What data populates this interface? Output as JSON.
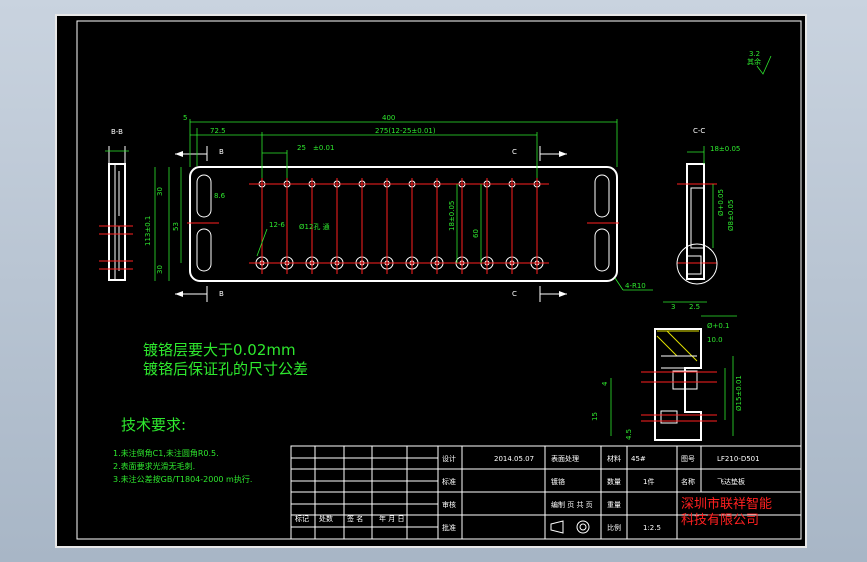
{
  "section_labels": {
    "bb": "B-B",
    "cc": "C-C",
    "b": "B",
    "c": "C"
  },
  "roughness": {
    "value": "3.2",
    "label": "其余"
  },
  "dimensions": {
    "d400": "400",
    "d5": "5",
    "d72_5": "72.5",
    "d275": "275(12-25±0.01)",
    "d25": "25",
    "d25tol": "±0.01",
    "d86": "8.6",
    "d30a": "30",
    "d53": "53",
    "d113": "113±0.1",
    "d30b": "30",
    "d12_6": "12-6",
    "d12_hole": "Ø12孔 通",
    "d18": "18±0.05",
    "d60": "60",
    "d4_r10": "4-R10",
    "c_top": "18±0.05",
    "c_v1": "Ø+0.05",
    "c_v2": "Ø8±0.05",
    "c_bottom_a": "3",
    "c_bottom_b": "2.5",
    "det_d1": "Ø+0.1",
    "det_d2": "10.0",
    "det_v1": "4",
    "det_v2": "15",
    "det_v3": "4.5",
    "det_v4": "Ø15±0.01"
  },
  "notes": {
    "plating_1": "镀铬层要大于0.02mm",
    "plating_2": "镀铬后保证孔的尺寸公差",
    "tech_title": "技术要求:",
    "tech_1": "1.未注倒角C1,未注圆角R0.5.",
    "tech_2": "2.表面要求光滑无毛刺.",
    "tech_3": "3.未注公差按GB/T1804-2000 m执行."
  },
  "title_block": {
    "design": "设计",
    "date": "2014.05.07",
    "surface_label": "表面处理",
    "material_label": "材料",
    "material_value": "45#",
    "drawing_no_label": "图号",
    "drawing_no_value": "LF210-D501",
    "standard": "标准",
    "plating": "镀铬",
    "qty_label": "数量",
    "qty_value": "1件",
    "name_label": "名称",
    "name_value": "飞达垫板",
    "review": "审核",
    "drawing": "编制 页 共 页",
    "weight": "重量",
    "approve": "批准",
    "scale_label": "比例",
    "scale_value": "1:2.5",
    "mark": "标记",
    "count": "处数",
    "sign": "签 名",
    "ymd": "年 月 日",
    "company_1": "深圳市联祥智能",
    "company_2": "科技有限公司"
  }
}
